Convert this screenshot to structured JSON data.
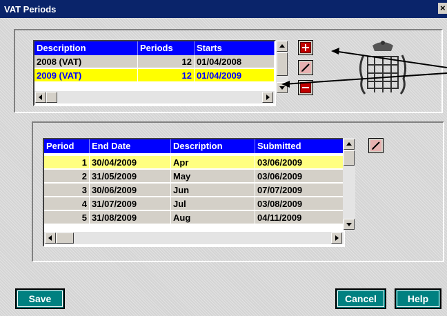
{
  "window": {
    "title": "VAT Periods",
    "close_glyph": "×"
  },
  "periods_table": {
    "headers": [
      "Description",
      "Periods",
      "Starts"
    ],
    "rows": [
      {
        "description": "2008 (VAT)",
        "periods": "12",
        "starts": "01/04/2008",
        "selected": false
      },
      {
        "description": "2009 (VAT)",
        "periods": "12",
        "starts": "01/04/2009",
        "selected": true
      }
    ]
  },
  "period_actions": [
    {
      "name": "add-period-button",
      "icon": "plus-icon"
    },
    {
      "name": "edit-period-button",
      "icon": "pencil-icon"
    },
    {
      "name": "remove-period-button",
      "icon": "minus-icon"
    }
  ],
  "details_table": {
    "headers": [
      "Period",
      "End Date",
      "Description",
      "Submitted"
    ],
    "rows": [
      {
        "period": "1",
        "end_date": "30/04/2009",
        "description": "Apr",
        "submitted": "03/06/2009",
        "selected": true
      },
      {
        "period": "2",
        "end_date": "31/05/2009",
        "description": "May",
        "submitted": "03/06/2009",
        "selected": false
      },
      {
        "period": "3",
        "end_date": "30/06/2009",
        "description": "Jun",
        "submitted": "07/07/2009",
        "selected": false
      },
      {
        "period": "4",
        "end_date": "31/07/2009",
        "description": "Jul",
        "submitted": "03/08/2009",
        "selected": false
      },
      {
        "period": "5",
        "end_date": "31/08/2009",
        "description": "Aug",
        "submitted": "04/11/2009",
        "selected": false
      }
    ]
  },
  "buttons": {
    "save": "Save",
    "cancel": "Cancel",
    "help": "Help"
  },
  "colors": {
    "header_bg": "#0000ff",
    "selected_row": "#ffff00",
    "button_teal": "#008080",
    "title_bar": "#0a246a"
  }
}
